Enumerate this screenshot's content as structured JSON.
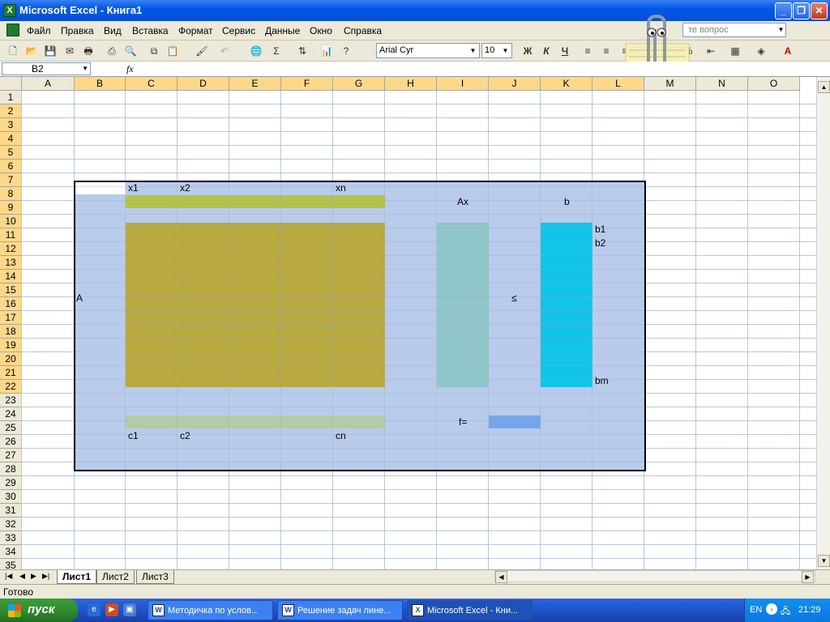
{
  "window": {
    "title": "Microsoft Excel - Книга1"
  },
  "menu": [
    "Файл",
    "Правка",
    "Вид",
    "Вставка",
    "Формат",
    "Сервис",
    "Данные",
    "Окно",
    "Справка"
  ],
  "ask_placeholder": "те вопрос",
  "toolbar": {
    "font_name": "Arial Cyr",
    "font_size": "10",
    "bold": "Ж",
    "italic": "К",
    "underline": "Ч"
  },
  "formula_bar": {
    "name_box": "B2",
    "fx": "fx",
    "content": ""
  },
  "columns": [
    "A",
    "B",
    "C",
    "D",
    "E",
    "F",
    "G",
    "H",
    "I",
    "J",
    "K",
    "L",
    "M",
    "N",
    "O"
  ],
  "rows": [
    "1",
    "2",
    "3",
    "4",
    "5",
    "6",
    "7",
    "8",
    "9",
    "10",
    "11",
    "12",
    "13",
    "14",
    "15",
    "16",
    "17",
    "18",
    "19",
    "20",
    "21",
    "22",
    "23",
    "24",
    "25",
    "26",
    "27",
    "28",
    "29",
    "30",
    "31",
    "32",
    "33",
    "34",
    "35"
  ],
  "cells": {
    "x1": "x1",
    "x2": "x2",
    "xn": "xn",
    "ax": "Ax",
    "b": "b",
    "b1": "b1",
    "b2": "b2",
    "bm": "bm",
    "a": "A",
    "le": "≤",
    "f": "f=",
    "c1": "c1",
    "c2": "c2",
    "cn": "cn"
  },
  "colors": {
    "region": "#b9cbeb",
    "x_row": "#b5c342",
    "matrix": "#b8a940",
    "ax_col": "#8fc6c9",
    "b_col": "#11c4e8",
    "c_row": "#b5cba6",
    "f_cell": "#74a6ec"
  },
  "sheets": [
    "Лист1",
    "Лист2",
    "Лист3"
  ],
  "status": "Готово",
  "taskbar": {
    "start": "пуск",
    "tasks": [
      "Методичка по услов...",
      "Решение задач лине...",
      "Microsoft Excel - Кни..."
    ],
    "lang": "EN",
    "time": "21:29"
  }
}
